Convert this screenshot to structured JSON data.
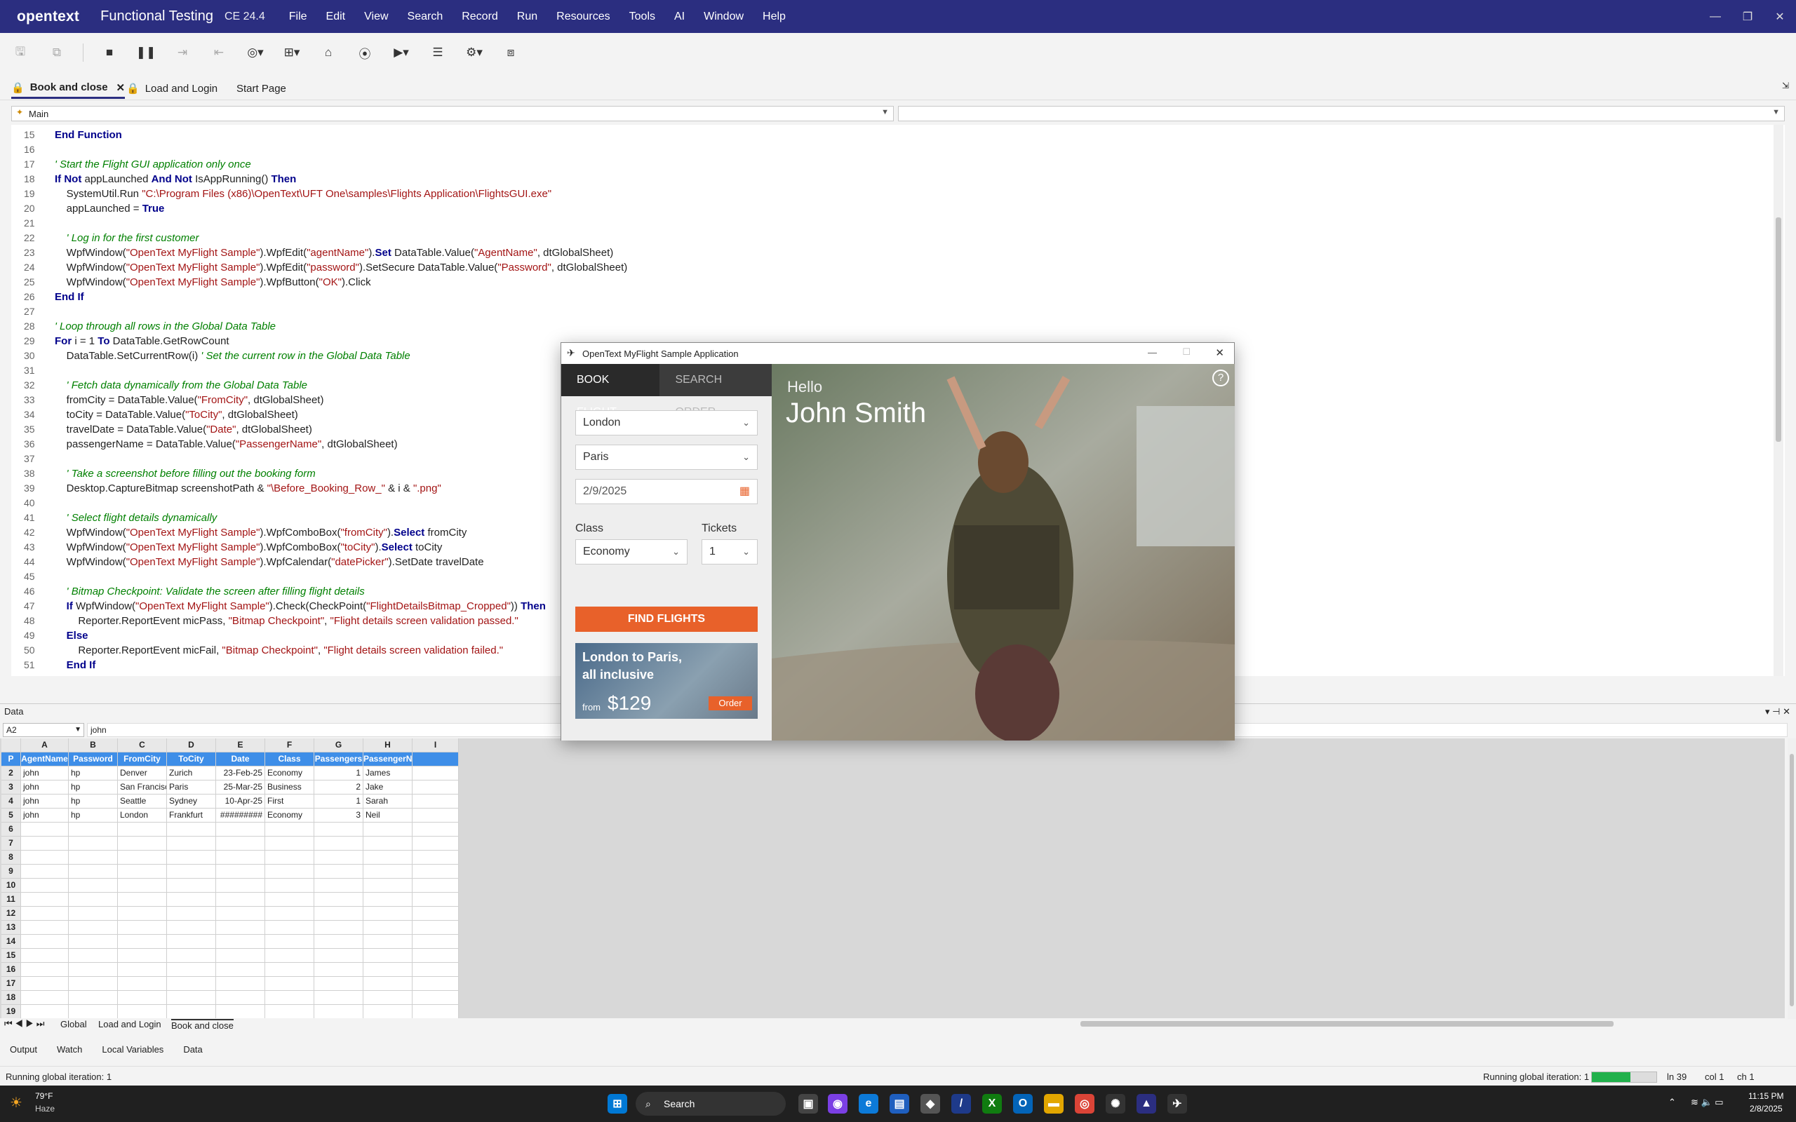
{
  "titlebar": {
    "brand": "opentext",
    "app_name": "Functional Testing",
    "version": "CE 24.4",
    "menu": [
      "File",
      "Edit",
      "View",
      "Search",
      "Record",
      "Run",
      "Resources",
      "Tools",
      "AI",
      "Window",
      "Help"
    ]
  },
  "doc_tabs": [
    "Book and close",
    "Load and Login",
    "Start Page"
  ],
  "editor": {
    "procedure": "Main",
    "lines": [
      {
        "n": "15",
        "html": "<span class='kw'>End Function</span>"
      },
      {
        "n": "16",
        "html": ""
      },
      {
        "n": "17",
        "html": "<span class='cm'>' Start the Flight GUI application only once</span>"
      },
      {
        "n": "18",
        "html": "<span class='kw'>If Not</span> appLaunched <span class='kw'>And Not</span> IsAppRunning() <span class='kw'>Then</span>"
      },
      {
        "n": "19",
        "html": "    SystemUtil.Run <span class='st'>\"C:\\Program Files (x86)\\OpenText\\UFT One\\samples\\Flights Application\\FlightsGUI.exe\"</span>"
      },
      {
        "n": "20",
        "html": "    appLaunched = <span class='kw'>True</span>"
      },
      {
        "n": "21",
        "html": ""
      },
      {
        "n": "22",
        "html": "    <span class='cm'>' Log in for the first customer</span>"
      },
      {
        "n": "23",
        "html": "    WpfWindow(<span class='st'>\"OpenText MyFlight Sample\"</span>).WpfEdit(<span class='st'>\"agentName\"</span>).<span class='kw'>Set</span> DataTable.Value(<span class='st'>\"AgentName\"</span>, dtGlobalSheet)"
      },
      {
        "n": "24",
        "html": "    WpfWindow(<span class='st'>\"OpenText MyFlight Sample\"</span>).WpfEdit(<span class='st'>\"password\"</span>).SetSecure DataTable.Value(<span class='st'>\"Password\"</span>, dtGlobalSheet)"
      },
      {
        "n": "25",
        "html": "    WpfWindow(<span class='st'>\"OpenText MyFlight Sample\"</span>).WpfButton(<span class='st'>\"OK\"</span>).Click"
      },
      {
        "n": "26",
        "html": "<span class='kw'>End If</span>"
      },
      {
        "n": "27",
        "html": ""
      },
      {
        "n": "28",
        "html": "<span class='cm'>' Loop through all rows in the Global Data Table</span>"
      },
      {
        "n": "29",
        "html": "<span class='kw'>For</span> i = 1 <span class='kw'>To</span> DataTable.GetRowCount"
      },
      {
        "n": "30",
        "html": "    DataTable.SetCurrentRow(i) <span class='cm'>' Set the current row in the Global Data Table</span>"
      },
      {
        "n": "31",
        "html": ""
      },
      {
        "n": "32",
        "html": "    <span class='cm'>' Fetch data dynamically from the Global Data Table</span>"
      },
      {
        "n": "33",
        "html": "    fromCity = DataTable.Value(<span class='st'>\"FromCity\"</span>, dtGlobalSheet)"
      },
      {
        "n": "34",
        "html": "    toCity = DataTable.Value(<span class='st'>\"ToCity\"</span>, dtGlobalSheet)"
      },
      {
        "n": "35",
        "html": "    travelDate = DataTable.Value(<span class='st'>\"Date\"</span>, dtGlobalSheet)"
      },
      {
        "n": "36",
        "html": "    passengerName = DataTable.Value(<span class='st'>\"PassengerName\"</span>, dtGlobalSheet)"
      },
      {
        "n": "37",
        "html": ""
      },
      {
        "n": "38",
        "html": "    <span class='cm'>' Take a screenshot before filling out the booking form</span>"
      },
      {
        "n": "39",
        "html": "    Desktop.CaptureBitmap screenshotPath &amp; <span class='st'>\"\\Before_Booking_Row_\"</span> &amp; i &amp; <span class='st'>\".png\"</span>"
      },
      {
        "n": "40",
        "html": ""
      },
      {
        "n": "41",
        "html": "    <span class='cm'>' Select flight details dynamically</span>"
      },
      {
        "n": "42",
        "html": "    WpfWindow(<span class='st'>\"OpenText MyFlight Sample\"</span>).WpfComboBox(<span class='st'>\"fromCity\"</span>).<span class='kw'>Select</span> fromCity"
      },
      {
        "n": "43",
        "html": "    WpfWindow(<span class='st'>\"OpenText MyFlight Sample\"</span>).WpfComboBox(<span class='st'>\"toCity\"</span>).<span class='kw'>Select</span> toCity"
      },
      {
        "n": "44",
        "html": "    WpfWindow(<span class='st'>\"OpenText MyFlight Sample\"</span>).WpfCalendar(<span class='st'>\"datePicker\"</span>).SetDate travelDate"
      },
      {
        "n": "45",
        "html": ""
      },
      {
        "n": "46",
        "html": "    <span class='cm'>' Bitmap Checkpoint: Validate the screen after filling flight details</span>"
      },
      {
        "n": "47",
        "html": "    <span class='kw'>If</span> WpfWindow(<span class='st'>\"OpenText MyFlight Sample\"</span>).Check(CheckPoint(<span class='st'>\"FlightDetailsBitmap_Cropped\"</span>)) <span class='kw'>Then</span>"
      },
      {
        "n": "48",
        "html": "        Reporter.ReportEvent micPass, <span class='st'>\"Bitmap Checkpoint\"</span>, <span class='st'>\"Flight details screen validation passed.\"</span>"
      },
      {
        "n": "49",
        "html": "    <span class='kw'>Else</span>"
      },
      {
        "n": "50",
        "html": "        Reporter.ReportEvent micFail, <span class='st'>\"Bitmap Checkpoint\"</span>, <span class='st'>\"Flight details screen validation failed.\"</span>"
      },
      {
        "n": "51",
        "html": "    <span class='kw'>End If</span>"
      }
    ]
  },
  "data_pane": {
    "title": "Data",
    "cell_ref": "A2",
    "cell_value": "john",
    "columns": [
      "A",
      "B",
      "C",
      "D",
      "E",
      "F",
      "G",
      "H",
      "I"
    ],
    "header_row_label": "P",
    "headers": [
      "AgentName",
      "Password",
      "FromCity",
      "ToCity",
      "Date",
      "Class",
      "Passengers",
      "PassengerName",
      ""
    ],
    "rows": [
      [
        "john",
        "hp",
        "Denver",
        "Zurich",
        "23-Feb-25",
        "Economy",
        "1",
        "James"
      ],
      [
        "john",
        "hp",
        "San Francisco",
        "Paris",
        "25-Mar-25",
        "Business",
        "2",
        "Jake"
      ],
      [
        "john",
        "hp",
        "Seattle",
        "Sydney",
        "10-Apr-25",
        "First",
        "1",
        "Sarah"
      ],
      [
        "john",
        "hp",
        "London",
        "Frankfurt",
        "#########",
        "Economy",
        "3",
        "Neil"
      ]
    ],
    "row_numbers": [
      "2",
      "3",
      "4",
      "5",
      "6",
      "7",
      "8",
      "9",
      "10",
      "11",
      "12",
      "13",
      "14",
      "15",
      "16",
      "17",
      "18",
      "19"
    ],
    "sheet_tabs": [
      "Global",
      "Load and Login",
      "Book and close"
    ]
  },
  "bottom_tabs": [
    "Output",
    "Watch",
    "Local Variables",
    "Data"
  ],
  "status": {
    "left": "Running global iteration: 1",
    "right": "Running global iteration: 1",
    "ln": "ln 39",
    "col": "col 1",
    "ch": "ch 1"
  },
  "flight_app": {
    "title": "OpenText MyFlight Sample Application",
    "tabs": [
      "BOOK FLIGHT",
      "SEARCH ORDER"
    ],
    "from_city": "London",
    "to_city": "Paris",
    "date": "2/9/2025",
    "class_label": "Class",
    "class_value": "Economy",
    "tickets_label": "Tickets",
    "tickets_value": "1",
    "find_button": "FIND FLIGHTS",
    "promo": {
      "line1": "London to Paris,",
      "line2": "all inclusive",
      "from": "from",
      "price": "$129",
      "order": "Order"
    },
    "greeting": "Hello",
    "user_name": "John Smith",
    "help": "?"
  },
  "taskbar": {
    "weather_temp": "79°F",
    "weather_desc": "Haze",
    "search": "Search",
    "time": "11:15 PM",
    "date": "2/8/2025"
  },
  "colors": {
    "titlebar": "#2b2e80",
    "accent_orange": "#e8612a",
    "grid_header": "#3e8ee8",
    "progress": "#22b14c"
  }
}
